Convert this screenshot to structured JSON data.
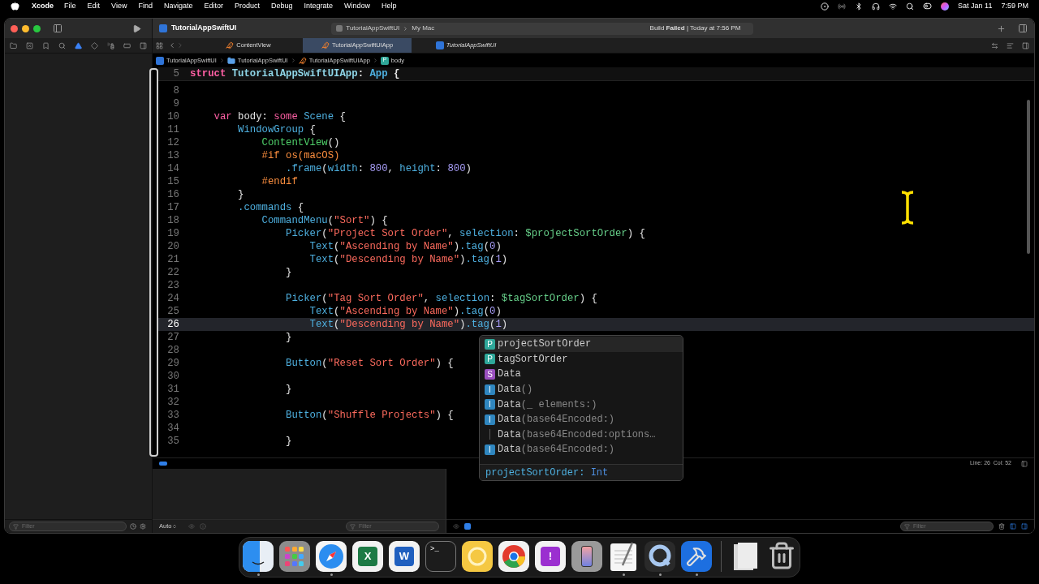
{
  "menu_bar": {
    "app": "Xcode",
    "items": [
      "File",
      "Edit",
      "View",
      "Find",
      "Navigate",
      "Editor",
      "Product",
      "Debug",
      "Integrate",
      "Window",
      "Help"
    ],
    "date": "Sat Jan 11",
    "time": "7:59 PM"
  },
  "toolbar": {
    "project": "TutorialAppSwiftUI",
    "scheme": "TutorialAppSwiftUI",
    "destination": "My Mac",
    "status": "Build **Failed** | Today at 7:56 PM"
  },
  "tabs": [
    {
      "label": "ContentView",
      "kind": "swift",
      "selected": false,
      "preview": false
    },
    {
      "label": "TutorialAppSwiftUIApp",
      "kind": "swift",
      "selected": true,
      "preview": false
    },
    {
      "label": "TutorialAppSwiftUI",
      "kind": "project",
      "selected": false,
      "preview": true
    }
  ],
  "breadcrumb": [
    {
      "label": "TutorialAppSwiftUI",
      "kind": "project"
    },
    {
      "label": "TutorialAppSwiftUI",
      "kind": "folder"
    },
    {
      "label": "TutorialAppSwiftUIApp",
      "kind": "swift"
    },
    {
      "label": "body",
      "kind": "property",
      "badge": "P"
    }
  ],
  "editor": {
    "sticky": {
      "number": "5",
      "tokens": [
        {
          "text": "struct ",
          "kind": "keyword"
        },
        {
          "text": "TutorialAppSwiftUIApp",
          "kind": "project_type"
        },
        {
          "text": ": ",
          "kind": "plain"
        },
        {
          "text": "App",
          "kind": "type"
        },
        {
          "text": " {",
          "kind": "plain"
        }
      ]
    },
    "lines": [
      {
        "number": "8",
        "current": false
      },
      {
        "number": "9",
        "current": false
      },
      {
        "number": "10",
        "current": false,
        "tokens": [
          {
            "text": "    var",
            "kind": "keyword"
          },
          {
            "text": " body: ",
            "kind": "plain"
          },
          {
            "text": "some",
            "kind": "keyword"
          },
          {
            "text": " Scene",
            "kind": "type"
          },
          {
            "text": " {",
            "kind": "plain"
          }
        ]
      },
      {
        "number": "11",
        "current": false,
        "tokens": [
          {
            "text": "        WindowGroup",
            "kind": "type"
          },
          {
            "text": " {",
            "kind": "plain"
          }
        ]
      },
      {
        "number": "12",
        "current": false,
        "tokens": [
          {
            "text": "            ContentView",
            "kind": "function"
          },
          {
            "text": "()",
            "kind": "plain"
          }
        ]
      },
      {
        "number": "13",
        "current": false,
        "tokens": [
          {
            "text": "            #if os(macOS)",
            "kind": "preprocessor"
          }
        ]
      },
      {
        "number": "14",
        "current": false,
        "tokens": [
          {
            "text": "                .frame",
            "kind": "member"
          },
          {
            "text": "(",
            "kind": "plain"
          },
          {
            "text": "width",
            "kind": "member"
          },
          {
            "text": ": ",
            "kind": "plain"
          },
          {
            "text": "800",
            "kind": "number"
          },
          {
            "text": ", ",
            "kind": "plain"
          },
          {
            "text": "height",
            "kind": "member"
          },
          {
            "text": ": ",
            "kind": "plain"
          },
          {
            "text": "800",
            "kind": "number"
          },
          {
            "text": ")",
            "kind": "plain"
          }
        ]
      },
      {
        "number": "15",
        "current": false,
        "tokens": [
          {
            "text": "            #endif",
            "kind": "preprocessor"
          }
        ]
      },
      {
        "number": "16",
        "current": false,
        "tokens": [
          {
            "text": "        }",
            "kind": "plain"
          }
        ]
      },
      {
        "number": "17",
        "current": false,
        "tokens": [
          {
            "text": "        .commands",
            "kind": "member"
          },
          {
            "text": " {",
            "kind": "plain"
          }
        ]
      },
      {
        "number": "18",
        "current": false,
        "tokens": [
          {
            "text": "            CommandMenu",
            "kind": "type"
          },
          {
            "text": "(",
            "kind": "plain"
          },
          {
            "text": "\"Sort\"",
            "kind": "string"
          },
          {
            "text": ") {",
            "kind": "plain"
          }
        ]
      },
      {
        "number": "19",
        "current": false,
        "tokens": [
          {
            "text": "                Picker",
            "kind": "type"
          },
          {
            "text": "(",
            "kind": "plain"
          },
          {
            "text": "\"Project Sort Order\"",
            "kind": "string"
          },
          {
            "text": ", ",
            "kind": "plain"
          },
          {
            "text": "selection",
            "kind": "member"
          },
          {
            "text": ": ",
            "kind": "plain"
          },
          {
            "text": "$projectSortOrder",
            "kind": "binding"
          },
          {
            "text": ") {",
            "kind": "plain"
          }
        ]
      },
      {
        "number": "20",
        "current": false,
        "tokens": [
          {
            "text": "                    Text",
            "kind": "type"
          },
          {
            "text": "(",
            "kind": "plain"
          },
          {
            "text": "\"Ascending by Name\"",
            "kind": "string"
          },
          {
            "text": ")",
            "kind": "plain"
          },
          {
            "text": ".tag",
            "kind": "member"
          },
          {
            "text": "(",
            "kind": "plain"
          },
          {
            "text": "0",
            "kind": "number"
          },
          {
            "text": ")",
            "kind": "plain"
          }
        ]
      },
      {
        "number": "21",
        "current": false,
        "tokens": [
          {
            "text": "                    Text",
            "kind": "type"
          },
          {
            "text": "(",
            "kind": "plain"
          },
          {
            "text": "\"Descending by Name\"",
            "kind": "string"
          },
          {
            "text": ")",
            "kind": "plain"
          },
          {
            "text": ".tag",
            "kind": "member"
          },
          {
            "text": "(",
            "kind": "plain"
          },
          {
            "text": "1",
            "kind": "number"
          },
          {
            "text": ")",
            "kind": "plain"
          }
        ]
      },
      {
        "number": "22",
        "current": false,
        "tokens": [
          {
            "text": "                }",
            "kind": "plain"
          }
        ]
      },
      {
        "number": "23",
        "current": false
      },
      {
        "number": "24",
        "current": false,
        "tokens": [
          {
            "text": "                Picker",
            "kind": "type"
          },
          {
            "text": "(",
            "kind": "plain"
          },
          {
            "text": "\"Tag Sort Order\"",
            "kind": "string"
          },
          {
            "text": ", ",
            "kind": "plain"
          },
          {
            "text": "selection",
            "kind": "member"
          },
          {
            "text": ": ",
            "kind": "plain"
          },
          {
            "text": "$tagSortOrder",
            "kind": "binding"
          },
          {
            "text": ") {",
            "kind": "plain"
          }
        ]
      },
      {
        "number": "25",
        "current": false,
        "tokens": [
          {
            "text": "                    Text",
            "kind": "type"
          },
          {
            "text": "(",
            "kind": "plain"
          },
          {
            "text": "\"Ascending by Name\"",
            "kind": "string"
          },
          {
            "text": ")",
            "kind": "plain"
          },
          {
            "text": ".tag",
            "kind": "member"
          },
          {
            "text": "(",
            "kind": "plain"
          },
          {
            "text": "0",
            "kind": "number"
          },
          {
            "text": ")",
            "kind": "plain"
          }
        ]
      },
      {
        "number": "26",
        "current": true,
        "tokens": [
          {
            "text": "                    Text",
            "kind": "type"
          },
          {
            "text": "(",
            "kind": "plain"
          },
          {
            "text": "\"Descending by Name\"",
            "kind": "string"
          },
          {
            "text": ")",
            "kind": "plain"
          },
          {
            "text": ".tag",
            "kind": "member"
          },
          {
            "text": "(",
            "kind": "plain"
          },
          {
            "text": "1",
            "kind": "number"
          },
          {
            "text": ")",
            "kind": "plain"
          }
        ]
      },
      {
        "number": "27",
        "current": false,
        "tokens": [
          {
            "text": "                }",
            "kind": "plain"
          }
        ]
      },
      {
        "number": "28",
        "current": false
      },
      {
        "number": "29",
        "current": false,
        "tokens": [
          {
            "text": "                Button",
            "kind": "type"
          },
          {
            "text": "(",
            "kind": "plain"
          },
          {
            "text": "\"Reset Sort Order\"",
            "kind": "string"
          },
          {
            "text": ") {",
            "kind": "plain"
          }
        ]
      },
      {
        "number": "30",
        "current": false
      },
      {
        "number": "31",
        "current": false,
        "tokens": [
          {
            "text": "                }",
            "kind": "plain"
          }
        ]
      },
      {
        "number": "32",
        "current": false
      },
      {
        "number": "33",
        "current": false,
        "tokens": [
          {
            "text": "                Button",
            "kind": "type"
          },
          {
            "text": "(",
            "kind": "plain"
          },
          {
            "text": "\"Shuffle Projects\"",
            "kind": "string"
          },
          {
            "text": ") {",
            "kind": "plain"
          }
        ]
      },
      {
        "number": "34",
        "current": false
      },
      {
        "number": "35",
        "current": false,
        "tokens": [
          {
            "text": "                }",
            "kind": "plain"
          }
        ]
      }
    ]
  },
  "completion": {
    "items": [
      {
        "badge": "P",
        "kind": "property",
        "label": "projectSortOrder",
        "selected": true
      },
      {
        "badge": "P",
        "kind": "property",
        "label": "tagSortOrder",
        "selected": false
      },
      {
        "badge": "S",
        "kind": "struct",
        "label": "Data",
        "selected": false
      },
      {
        "badge": "I",
        "kind": "initializer",
        "label": "Data",
        "detail": "()",
        "selected": false
      },
      {
        "badge": "I",
        "kind": "initializer",
        "label": "Data",
        "detail": "(_ elements:)",
        "selected": false
      },
      {
        "badge": "I",
        "kind": "initializer",
        "label": "Data",
        "detail": "(base64Encoded:)",
        "selected": false
      },
      {
        "kind": "overload",
        "label": "Data",
        "detail": "(base64Encoded:options…",
        "selected": false
      },
      {
        "badge": "I",
        "kind": "initializer",
        "label": "Data",
        "detail": "(base64Encoded:)",
        "selected": false
      }
    ],
    "footer_name": "projectSortOrder:",
    "footer_type": "Int"
  },
  "status_bar": {
    "position": "Line: 26  Col: 52"
  },
  "bottom_bar": {
    "navigator_filter": "Filter",
    "scope": "Auto",
    "variables_filter": "Filter",
    "console_filter": "Filter"
  },
  "dock": [
    {
      "kind": "finder",
      "running": true
    },
    {
      "kind": "launchpad",
      "running": false
    },
    {
      "kind": "safari",
      "running": true
    },
    {
      "kind": "letter",
      "glyph": "X",
      "color": "#1d7a45",
      "running": false
    },
    {
      "kind": "letter",
      "glyph": "W",
      "color": "#1f5fbf",
      "running": false
    },
    {
      "kind": "terminal",
      "glyph": ">_",
      "running": false
    },
    {
      "kind": "ring",
      "running": false
    },
    {
      "kind": "chrome",
      "running": false
    },
    {
      "kind": "letter",
      "glyph": "!",
      "color": "#9b2fd0",
      "running": false
    },
    {
      "kind": "phone",
      "running": false
    },
    {
      "kind": "textedit",
      "running": true
    },
    {
      "kind": "quicktime",
      "running": true
    },
    {
      "kind": "xcode",
      "running": true
    },
    {
      "kind": "divider"
    },
    {
      "kind": "stack",
      "running": false
    },
    {
      "kind": "trash",
      "running": false
    }
  ]
}
